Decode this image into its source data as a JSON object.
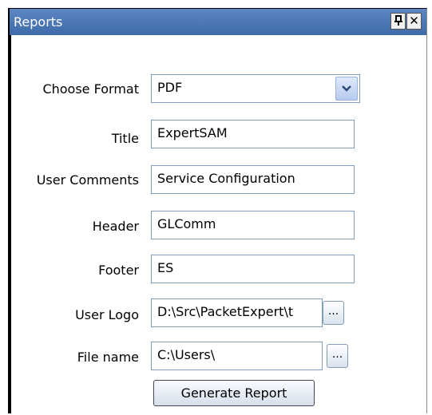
{
  "panel": {
    "title": "Reports"
  },
  "titlebar": {
    "pin_glyph": "ᵖ",
    "close_glyph": "✕"
  },
  "form": {
    "format_label": "Choose Format",
    "format_value": "PDF",
    "title_label": "Title",
    "title_value": "ExpertSAM",
    "comments_label": "User Comments",
    "comments_value": "Service Configuration",
    "header_label": "Header",
    "header_value": "GLComm",
    "footer_label": "Footer",
    "footer_value": "ES",
    "logo_label": "User Logo",
    "logo_value": "D:\\Src\\PacketExpert\\t",
    "filename_label": "File name",
    "filename_value": "C:\\Users\\",
    "browse_label": "...",
    "generate_label": "Generate Report"
  },
  "colors": {
    "titlebar": "#4a76b6",
    "field_border": "#7f9db9"
  }
}
